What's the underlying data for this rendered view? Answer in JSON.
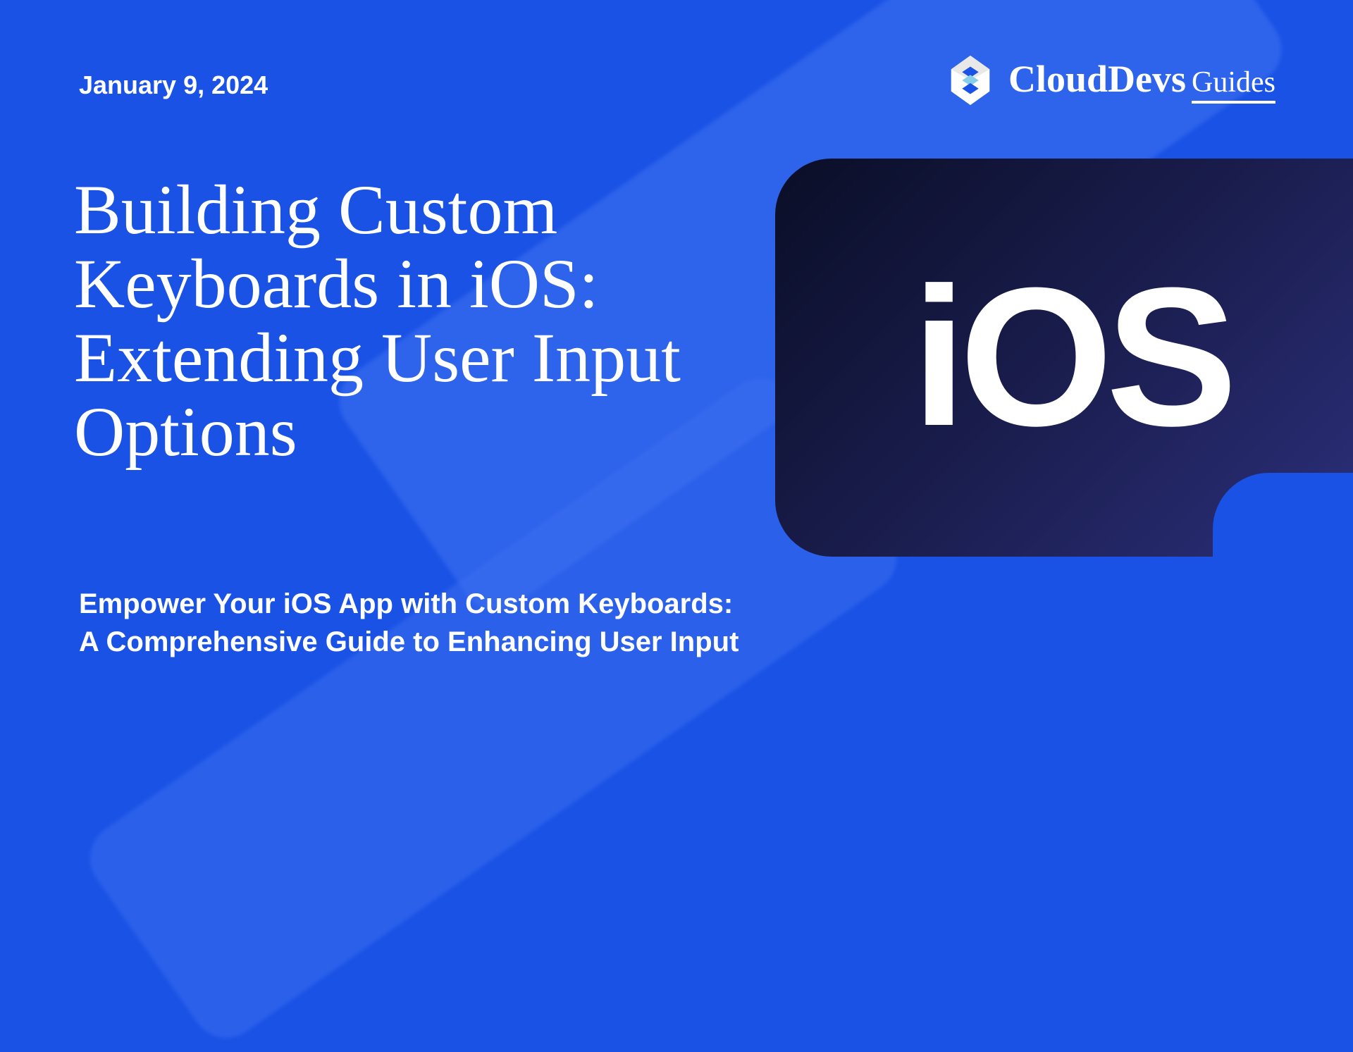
{
  "date": "January 9, 2024",
  "title": "Building Custom Keyboards in iOS: Extending User Input Options",
  "subtitle_line1": "Empower Your iOS App with Custom Keyboards:",
  "subtitle_line2": "A Comprehensive Guide to Enhancing User Input",
  "brand": {
    "main": "CloudDevs",
    "sub": "Guides"
  },
  "badge_text": "iOS",
  "colors": {
    "background": "#1952e5",
    "brush": "#3d6ff0",
    "badge_gradient_start": "#0a0e27",
    "badge_gradient_mid": "#1a1d4d",
    "badge_gradient_end": "#2b2f7a",
    "text": "#ffffff"
  }
}
